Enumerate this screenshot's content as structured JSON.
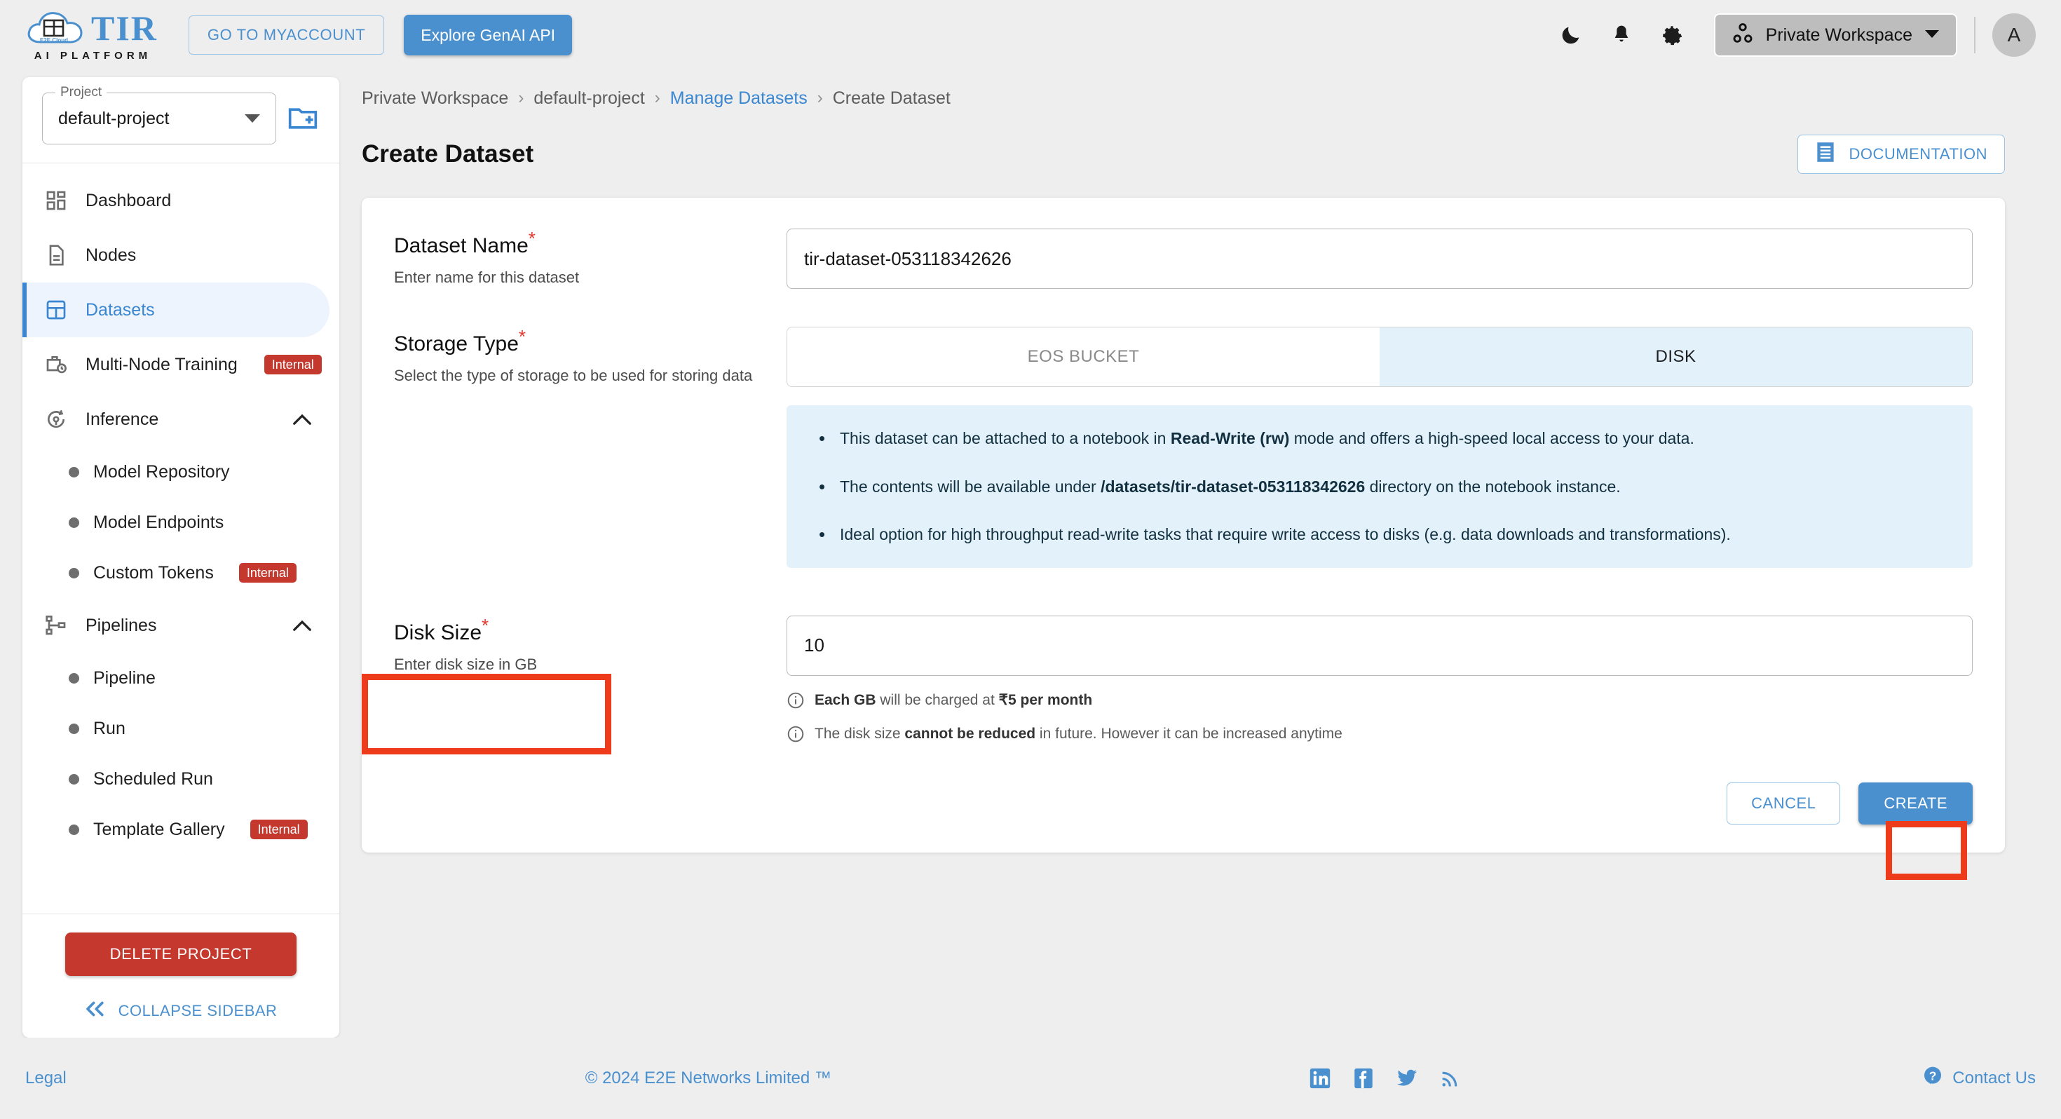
{
  "header": {
    "logo_title": "TIR",
    "logo_subtitle": "AI PLATFORM",
    "logo_badge": "E2E Cloud",
    "myaccount_label": "GO TO MYACCOUNT",
    "genai_label": "Explore GenAI API",
    "dark_mode_icon": "moon-icon",
    "notifications_icon": "bell-icon",
    "settings_icon": "gear-icon",
    "workspace_label": "Private Workspace",
    "avatar_initial": "A"
  },
  "sidebar": {
    "project_legend": "Project",
    "project_value": "default-project",
    "new_project_icon": "new-folder-icon",
    "items": [
      {
        "label": "Dashboard",
        "icon": "dashboard-icon",
        "active": false
      },
      {
        "label": "Nodes",
        "icon": "document-icon",
        "active": false
      },
      {
        "label": "Datasets",
        "icon": "grid-icon",
        "active": true
      },
      {
        "label": "Multi-Node Training",
        "icon": "briefcase-clock-icon",
        "badge": "Internal",
        "active": false
      },
      {
        "label": "Inference",
        "icon": "inference-icon",
        "expanded": true,
        "active": false
      },
      {
        "label": "Pipelines",
        "icon": "pipeline-icon",
        "expanded": true,
        "active": false
      }
    ],
    "inference_children": [
      {
        "label": "Model Repository"
      },
      {
        "label": "Model Endpoints"
      },
      {
        "label": "Custom Tokens",
        "badge": "Internal"
      }
    ],
    "pipelines_children": [
      {
        "label": "Pipeline"
      },
      {
        "label": "Run"
      },
      {
        "label": "Scheduled Run"
      },
      {
        "label": "Template Gallery",
        "badge": "Internal"
      }
    ],
    "delete_project_label": "DELETE PROJECT",
    "collapse_label": "COLLAPSE SIDEBAR"
  },
  "main": {
    "breadcrumb": [
      {
        "label": "Private Workspace",
        "link": false
      },
      {
        "label": "default-project",
        "link": false
      },
      {
        "label": "Manage Datasets",
        "link": true
      },
      {
        "label": "Create Dataset",
        "link": false
      }
    ],
    "breadcrumb_separator": "›",
    "page_title": "Create Dataset",
    "documentation_label": "DOCUMENTATION",
    "documentation_icon": "document-list-icon",
    "fields": {
      "dataset_name": {
        "label": "Dataset Name",
        "required_marker": "*",
        "sublabel": "Enter name for this dataset",
        "value": "tir-dataset-053118342626"
      },
      "storage_type": {
        "label": "Storage Type",
        "required_marker": "*",
        "sublabel": "Select the type of storage to be used for storing data",
        "options": [
          "EOS BUCKET",
          "DISK"
        ],
        "selected": "DISK"
      },
      "disk_size": {
        "label": "Disk Size",
        "required_marker": "*",
        "sublabel": "Enter disk size in GB",
        "value": "10"
      }
    },
    "info_bullets": [
      {
        "pre": "This dataset can be attached to a notebook in ",
        "strong": "Read-Write (rw)",
        "post": " mode and offers a high-speed local access to your data."
      },
      {
        "pre": "The contents will be available under ",
        "strong": "/datasets/tir-dataset-053118342626",
        "post": " directory on the notebook instance."
      },
      {
        "pre": "Ideal option for high throughput read-write tasks that require write access to disks (e.g. data downloads and transformations).",
        "strong": "",
        "post": ""
      }
    ],
    "hints": [
      {
        "icon": "info-icon",
        "strong": "Each GB",
        "mid": " will be charged at ",
        "strong2": "₹5 per month",
        "post": ""
      },
      {
        "icon": "info-icon",
        "pre": "The disk size ",
        "strong": "cannot be reduced",
        "post": " in future. However it can be increased anytime"
      }
    ],
    "cancel_label": "CANCEL",
    "create_label": "CREATE"
  },
  "footer": {
    "legal": "Legal",
    "copyright": "© 2024 E2E Networks Limited ™",
    "social": [
      "linkedin-icon",
      "facebook-icon",
      "twitter-icon",
      "rss-icon"
    ],
    "contact_label": "Contact Us",
    "contact_icon": "question-circle-icon"
  },
  "colors": {
    "accent": "#4a90cf",
    "danger": "#c4382e",
    "highlight": "#ee3b1c",
    "info_bg": "#e3f1fb"
  }
}
